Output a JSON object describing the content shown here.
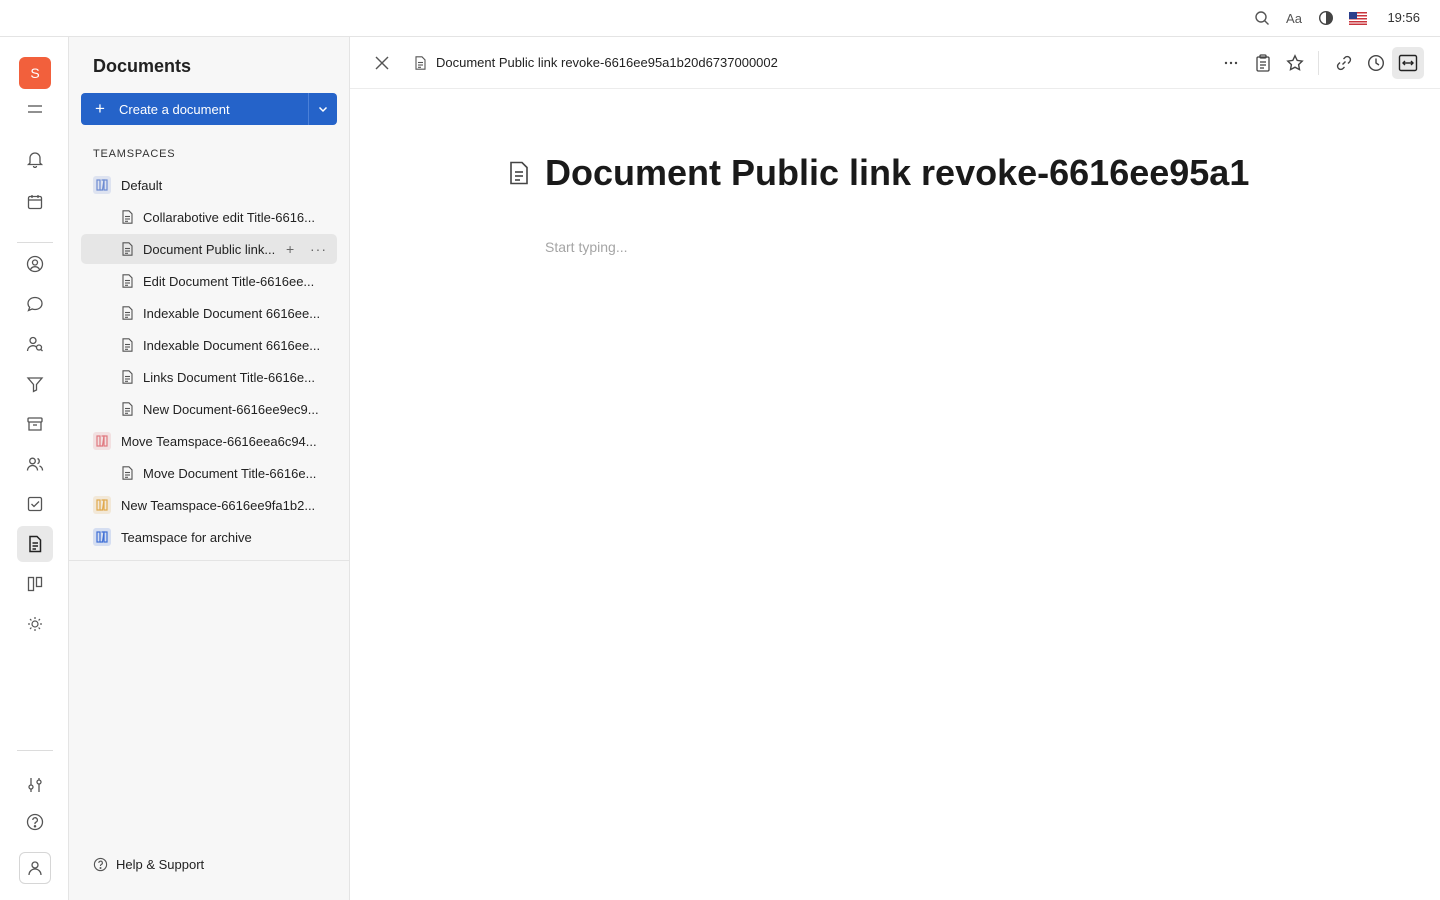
{
  "topbar": {
    "icons": [
      "search-icon",
      "font-size-icon",
      "contrast-icon",
      "us-flag-icon"
    ],
    "font_label": "Aa",
    "clock": "19:56"
  },
  "rail": {
    "logo_letter": "S",
    "icons": [
      "menu-icon",
      "bell-icon",
      "calendar-icon",
      "contact-icon",
      "chat-icon",
      "recruit-icon",
      "funnel-icon",
      "inbox-icon",
      "team-icon",
      "tasks-icon",
      "document-icon",
      "board-icon",
      "sun-icon",
      "settings-sliders-icon",
      "help-icon",
      "user-icon"
    ],
    "active": "document-icon"
  },
  "nav": {
    "title": "Documents",
    "create_label": "Create a document",
    "section_label": "TEAMSPACES",
    "tree": [
      {
        "type": "teamspace",
        "label": "Default",
        "color": "#6d8bd1"
      },
      {
        "type": "doc",
        "label": "Collarabotive edit Title-6616..."
      },
      {
        "type": "doc",
        "label": "Document Public link...",
        "active": true
      },
      {
        "type": "doc",
        "label": "Edit Document Title-6616ee..."
      },
      {
        "type": "doc",
        "label": "Indexable Document 6616ee..."
      },
      {
        "type": "doc",
        "label": "Indexable Document 6616ee..."
      },
      {
        "type": "doc",
        "label": "Links Document Title-6616e..."
      },
      {
        "type": "doc",
        "label": "New Document-6616ee9ec9..."
      },
      {
        "type": "teamspace",
        "label": "Move Teamspace-6616eea6c94...",
        "color": "#e0787f"
      },
      {
        "type": "doc",
        "label": "Move Document Title-6616e..."
      },
      {
        "type": "teamspace",
        "label": "New Teamspace-6616ee9fa1b2...",
        "color": "#e0a94c"
      },
      {
        "type": "teamspace",
        "label": "Teamspace for archive",
        "color": "#3f6fd6"
      }
    ],
    "help_label": "Help & Support"
  },
  "main": {
    "breadcrumb": "Document Public link revoke-6616ee95a1b20d6737000002",
    "title": "Document Public link revoke-6616ee95a1",
    "placeholder": "Start typing...",
    "actions": [
      "more-icon",
      "clipboard-icon",
      "star-icon",
      "link-icon",
      "history-icon",
      "expand-icon"
    ]
  }
}
